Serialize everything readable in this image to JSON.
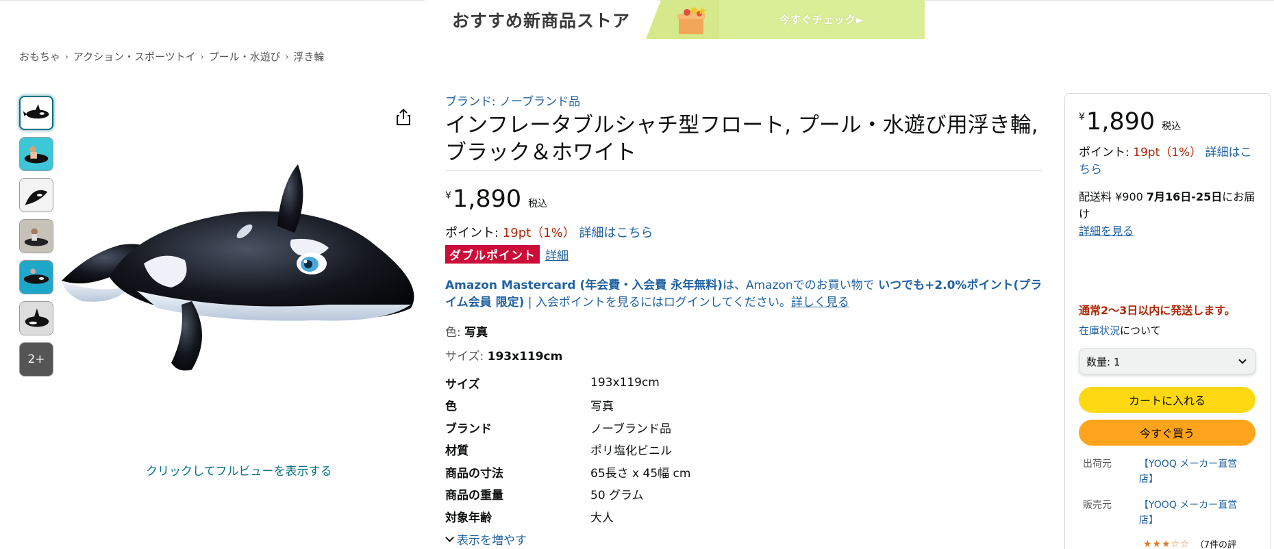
{
  "banner": {
    "store_title": "おすすめ新商品ストア",
    "cta_label": "今すぐチェック►"
  },
  "breadcrumb": [
    "おもちゃ",
    "アクション・スポーツトイ",
    "プール・水遊び",
    "浮き輪"
  ],
  "thumbnails": {
    "more_label": "2+"
  },
  "gallery": {
    "fullview_label": "クリックしてフルビューを表示する"
  },
  "product": {
    "brand_link": "ブランド: ノーブランド品",
    "title_line1": "インフレータブルシャチ型フロート, プール・水遊び用浮き輪,",
    "title_line2": "ブラック＆ホワイト",
    "price_symbol": "¥",
    "price": "1,890",
    "tax_label": "税込",
    "points_label": "ポイント: ",
    "points_value": "19pt（1%）",
    "points_link": "詳細はこちら",
    "double_points_badge": "ダブルポイント",
    "double_points_link": "詳細",
    "card_promo_bold": "Amazon Mastercard (年会費・入会費 永年無料)",
    "card_promo_mid": "は、Amazonでのお買い物で ",
    "card_promo_bold2": "いつでも+2.0%ポイント(プライム会員 限定)",
    "card_promo_tail": " | 入会ポイントを見るにはログインしてください。",
    "card_promo_link": "詳しく見る",
    "color_label": "色: ",
    "color_value": "写真",
    "size_label": "サイズ: ",
    "size_value": "193x119cm",
    "show_more": "表示を増やす"
  },
  "specs": [
    {
      "k": "サイズ",
      "v": "193x119cm"
    },
    {
      "k": "色",
      "v": "写真"
    },
    {
      "k": "ブランド",
      "v": "ノーブランド品"
    },
    {
      "k": "材質",
      "v": "ポリ塩化ビニル"
    },
    {
      "k": "商品の寸法",
      "v": "65長さ x 45幅 cm"
    },
    {
      "k": "商品の重量",
      "v": "50 グラム"
    },
    {
      "k": "対象年齢",
      "v": "大人"
    }
  ],
  "buybox": {
    "price_symbol": "¥",
    "price": "1,890",
    "tax_label": "税込",
    "points_label": "ポイント: ",
    "points_value": "19pt（1%）",
    "points_link": "詳細はこちら",
    "shipping_prefix": "配送料 ¥900 ",
    "shipping_dates": "7月16日-25日",
    "shipping_suffix": "にお届け",
    "shipping_link": "詳細を見る",
    "stock_status": "通常2～3日以内に発送します。",
    "stock_link": "在庫状況",
    "stock_note_suffix": "について",
    "quantity_label": "数量: 1",
    "add_to_cart": "カートに入れる",
    "buy_now": "今すぐ買う",
    "ships_from_label": "出荷元",
    "ships_from_value": "【YOOQ メーカー直営店】",
    "sold_by_label": "販売元",
    "sold_by_value": "【YOOQ メーカー直営店】",
    "rating_stars": "★★★☆☆",
    "rating_text": "（7件の評"
  },
  "colors": {
    "link": "#2162a1",
    "price_red": "#b12704",
    "badge": "#cc0c39",
    "cart_button": "#ffd814",
    "buy_button": "#ffa41c",
    "banner_green": "#d5e98a"
  }
}
